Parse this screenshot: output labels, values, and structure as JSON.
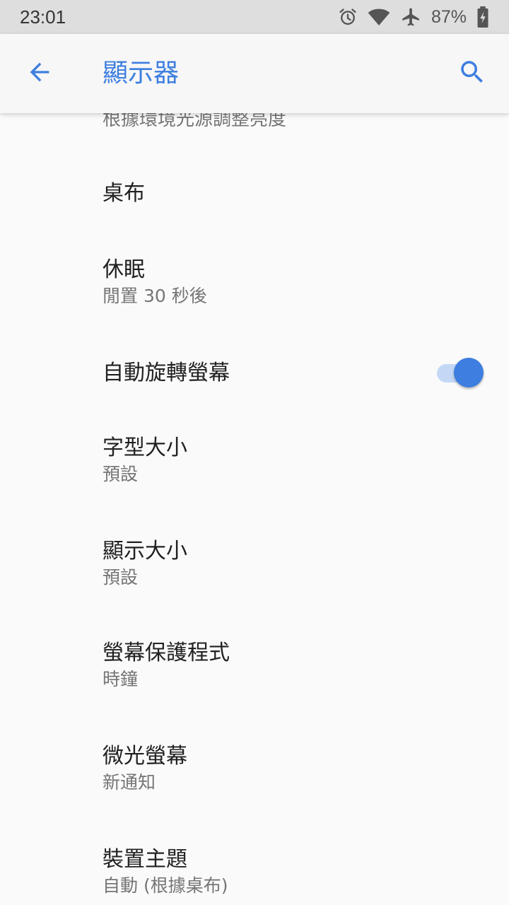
{
  "status_bar": {
    "time": "23:01",
    "battery": "87%",
    "icons": [
      "alarm-icon",
      "wifi-icon",
      "airplane-icon",
      "battery-charging-icon"
    ]
  },
  "app_bar": {
    "title": "顯示器",
    "back_icon": "arrow-left-icon",
    "search_icon": "search-icon"
  },
  "colors": {
    "accent": "#3d7ee0",
    "background": "#fafafa"
  },
  "settings": {
    "adaptive_partial": {
      "summary": "根據環境光源調整亮度"
    },
    "wallpaper": {
      "title": "桌布"
    },
    "sleep": {
      "title": "休眠",
      "summary": "閒置 30 秒後"
    },
    "auto_rotate": {
      "title": "自動旋轉螢幕",
      "enabled": true
    },
    "font_size": {
      "title": "字型大小",
      "summary": "預設"
    },
    "display_size": {
      "title": "顯示大小",
      "summary": "預設"
    },
    "screensaver": {
      "title": "螢幕保護程式",
      "summary": "時鐘"
    },
    "ambient": {
      "title": "微光螢幕",
      "summary": "新通知"
    },
    "theme": {
      "title": "裝置主題",
      "summary": "自動 (根據桌布)"
    }
  }
}
